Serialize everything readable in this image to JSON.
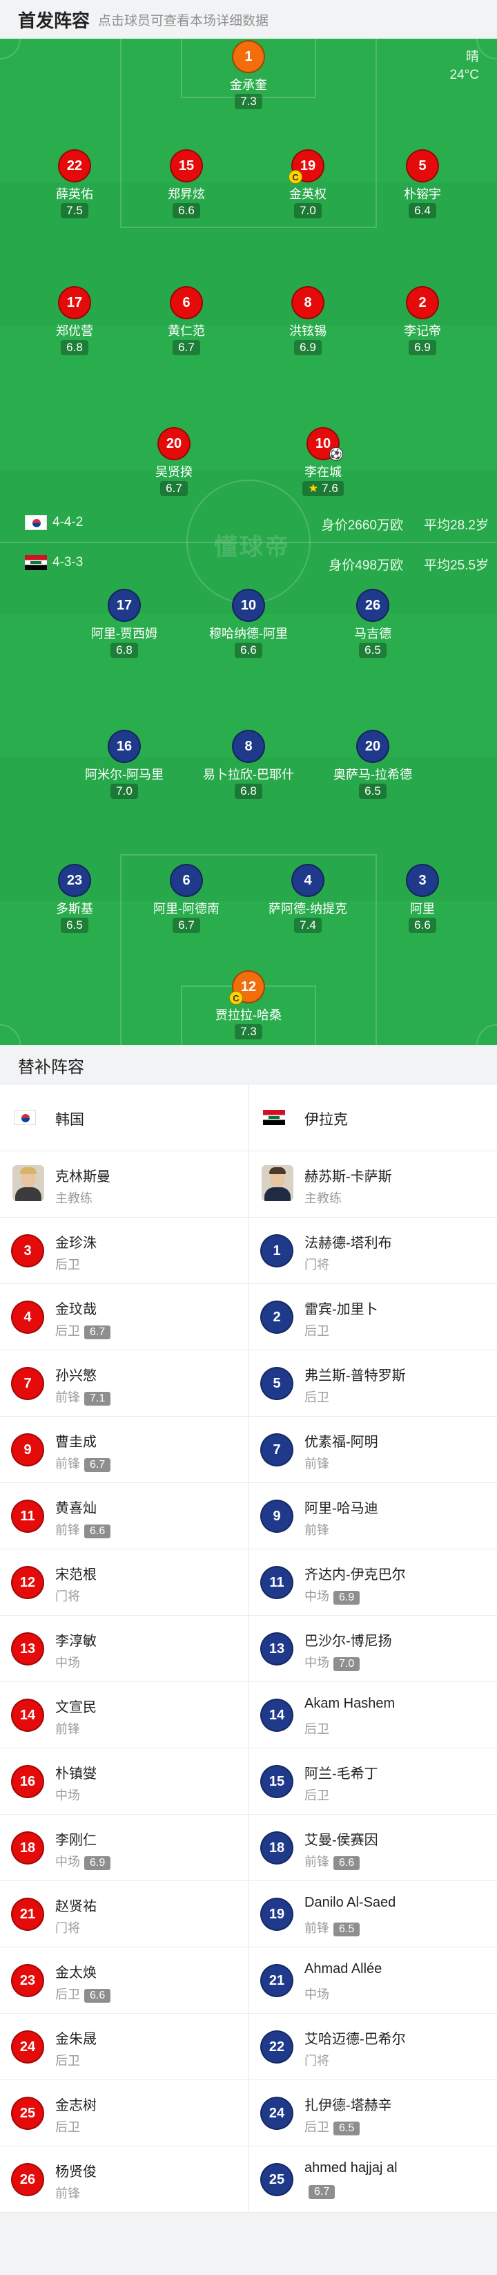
{
  "header": {
    "title": "首发阵容",
    "hint": "点击球员可查看本场详细数据"
  },
  "weather": {
    "condition": "晴",
    "temp": "24°C"
  },
  "watermark": "懂球帝",
  "home_team": {
    "name": "韩国",
    "formation": "4-4-2",
    "value": "身价2660万欧",
    "avg_age": "平均28.2岁",
    "flag": "korea-flag-icon"
  },
  "away_team": {
    "name": "伊拉克",
    "formation": "4-3-3",
    "value": "身价498万欧",
    "avg_age": "平均25.5岁",
    "flag": "iraq-flag-icon"
  },
  "home_players": [
    {
      "num": "1",
      "name": "金承奎",
      "rating": "7.3",
      "gk": true
    },
    {
      "num": "22",
      "name": "薛英佑",
      "rating": "7.5"
    },
    {
      "num": "15",
      "name": "郑昇炫",
      "rating": "6.6"
    },
    {
      "num": "19",
      "name": "金英权",
      "rating": "7.0",
      "captain": true
    },
    {
      "num": "5",
      "name": "朴镕宇",
      "rating": "6.4"
    },
    {
      "num": "17",
      "name": "郑优营",
      "rating": "6.8"
    },
    {
      "num": "6",
      "name": "黄仁范",
      "rating": "6.7"
    },
    {
      "num": "8",
      "name": "洪铉锡",
      "rating": "6.9"
    },
    {
      "num": "2",
      "name": "李记帝",
      "rating": "6.9"
    },
    {
      "num": "20",
      "name": "吴贤揆",
      "rating": "6.7"
    },
    {
      "num": "10",
      "name": "李在城",
      "rating": "7.6",
      "star": true,
      "goal": true
    }
  ],
  "away_players": [
    {
      "num": "17",
      "name": "阿里-贾西姆",
      "rating": "6.8"
    },
    {
      "num": "10",
      "name": "穆哈纳德-阿里",
      "rating": "6.6"
    },
    {
      "num": "26",
      "name": "马吉德",
      "rating": "6.5"
    },
    {
      "num": "16",
      "name": "阿米尔-阿马里",
      "rating": "7.0"
    },
    {
      "num": "8",
      "name": "易卜拉欣-巴耶什",
      "rating": "6.8"
    },
    {
      "num": "20",
      "name": "奥萨马-拉希德",
      "rating": "6.5"
    },
    {
      "num": "23",
      "name": "多斯基",
      "rating": "6.5"
    },
    {
      "num": "6",
      "name": "阿里-阿德南",
      "rating": "6.7"
    },
    {
      "num": "4",
      "name": "萨阿德-纳提克",
      "rating": "7.4"
    },
    {
      "num": "3",
      "name": "阿里",
      "rating": "6.6"
    },
    {
      "num": "12",
      "name": "贾拉拉-哈桑",
      "rating": "7.3",
      "gk": true,
      "captain": true
    }
  ],
  "subs_title": "替补阵容",
  "home_subs": {
    "team": "韩国",
    "coach": {
      "name": "克林斯曼",
      "role": "主教练"
    },
    "players": [
      {
        "num": "3",
        "name": "金珍洙",
        "pos": "后卫",
        "rating": ""
      },
      {
        "num": "4",
        "name": "金玟哉",
        "pos": "后卫",
        "rating": "6.7"
      },
      {
        "num": "7",
        "name": "孙兴慜",
        "pos": "前锋",
        "rating": "7.1"
      },
      {
        "num": "9",
        "name": "曹圭成",
        "pos": "前锋",
        "rating": "6.7"
      },
      {
        "num": "11",
        "name": "黄喜灿",
        "pos": "前锋",
        "rating": "6.6"
      },
      {
        "num": "12",
        "name": "宋范根",
        "pos": "门将",
        "rating": ""
      },
      {
        "num": "13",
        "name": "李淳敏",
        "pos": "中场",
        "rating": ""
      },
      {
        "num": "14",
        "name": "文宣民",
        "pos": "前锋",
        "rating": ""
      },
      {
        "num": "16",
        "name": "朴镇燮",
        "pos": "中场",
        "rating": ""
      },
      {
        "num": "18",
        "name": "李刚仁",
        "pos": "中场",
        "rating": "6.9"
      },
      {
        "num": "21",
        "name": "赵贤祐",
        "pos": "门将",
        "rating": ""
      },
      {
        "num": "23",
        "name": "金太焕",
        "pos": "后卫",
        "rating": "6.6"
      },
      {
        "num": "24",
        "name": "金朱晟",
        "pos": "后卫",
        "rating": ""
      },
      {
        "num": "25",
        "name": "金志树",
        "pos": "后卫",
        "rating": ""
      },
      {
        "num": "26",
        "name": "杨贤俊",
        "pos": "前锋",
        "rating": ""
      }
    ]
  },
  "away_subs": {
    "team": "伊拉克",
    "coach": {
      "name": "赫苏斯-卡萨斯",
      "role": "主教练"
    },
    "players": [
      {
        "num": "1",
        "name": "法赫德-塔利布",
        "pos": "门将",
        "rating": ""
      },
      {
        "num": "2",
        "name": "雷宾-加里卜",
        "pos": "后卫",
        "rating": ""
      },
      {
        "num": "5",
        "name": "弗兰斯-普特罗斯",
        "pos": "后卫",
        "rating": ""
      },
      {
        "num": "7",
        "name": "优素福-阿明",
        "pos": "前锋",
        "rating": ""
      },
      {
        "num": "9",
        "name": "阿里-哈马迪",
        "pos": "前锋",
        "rating": ""
      },
      {
        "num": "11",
        "name": "齐达内-伊克巴尔",
        "pos": "中场",
        "rating": "6.9"
      },
      {
        "num": "13",
        "name": "巴沙尔-博尼扬",
        "pos": "中场",
        "rating": "7.0"
      },
      {
        "num": "14",
        "name": "Akam Hashem",
        "pos": "后卫",
        "rating": ""
      },
      {
        "num": "15",
        "name": "阿兰-毛希丁",
        "pos": "后卫",
        "rating": ""
      },
      {
        "num": "18",
        "name": "艾曼-侯赛因",
        "pos": "前锋",
        "rating": "6.6"
      },
      {
        "num": "19",
        "name": "Danilo Al-Saed",
        "pos": "前锋",
        "rating": "6.5"
      },
      {
        "num": "21",
        "name": "Ahmad Allée",
        "pos": "中场",
        "rating": ""
      },
      {
        "num": "22",
        "name": "艾哈迈德-巴希尔",
        "pos": "门将",
        "rating": ""
      },
      {
        "num": "24",
        "name": "扎伊德-塔赫辛",
        "pos": "后卫",
        "rating": "6.5"
      },
      {
        "num": "25",
        "name": "ahmed hajjaj al",
        "pos": "",
        "rating": "6.7"
      }
    ]
  },
  "colors": {
    "pitch": "#27a84a",
    "home": "#e60b0b",
    "away": "#1f3a8a",
    "keeper": "#f26d0c"
  }
}
